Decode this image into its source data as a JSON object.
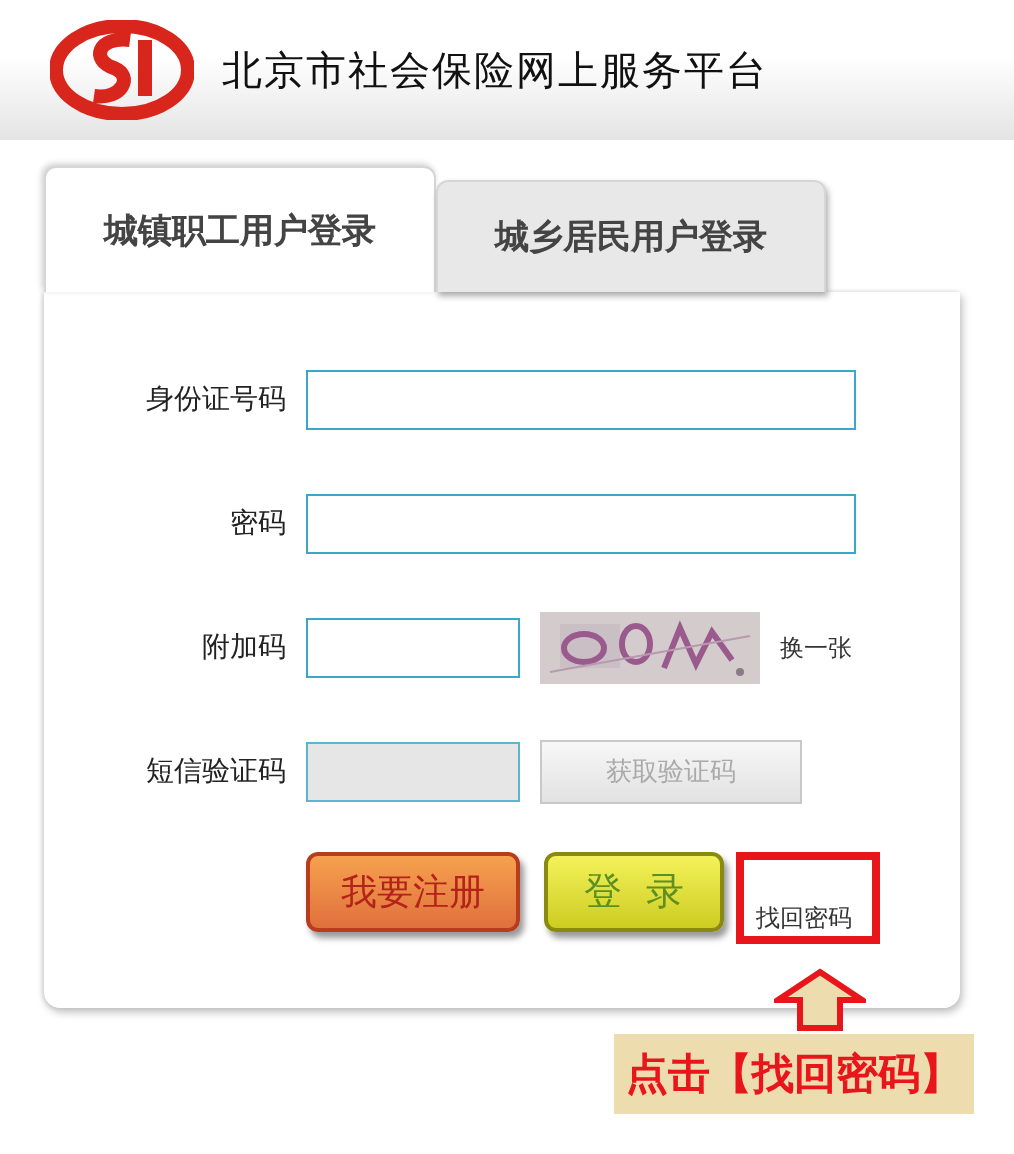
{
  "header": {
    "title": "北京市社会保险网上服务平台"
  },
  "tabs": [
    {
      "label": "城镇职工用户登录",
      "selected": true
    },
    {
      "label": "城乡居民用户登录",
      "selected": false
    }
  ],
  "form": {
    "fields": [
      {
        "kind": "text",
        "label": "身份证号码",
        "disabled": false
      },
      {
        "kind": "text",
        "label": "密码",
        "disabled": false
      },
      {
        "kind": "captcha",
        "label": "附加码",
        "disabled": false,
        "refresh_label": "换一张"
      },
      {
        "kind": "sms",
        "label": "短信验证码",
        "disabled": true,
        "button": {
          "label": "获取验证码",
          "disabled": true
        }
      }
    ],
    "buttons": [
      {
        "kind": "register",
        "label": "我要注册"
      },
      {
        "kind": "login",
        "label": "登  录"
      }
    ],
    "link": {
      "label": "找回密码",
      "highlighted": true
    }
  },
  "annotation": {
    "text": "点击【找回密码】"
  }
}
